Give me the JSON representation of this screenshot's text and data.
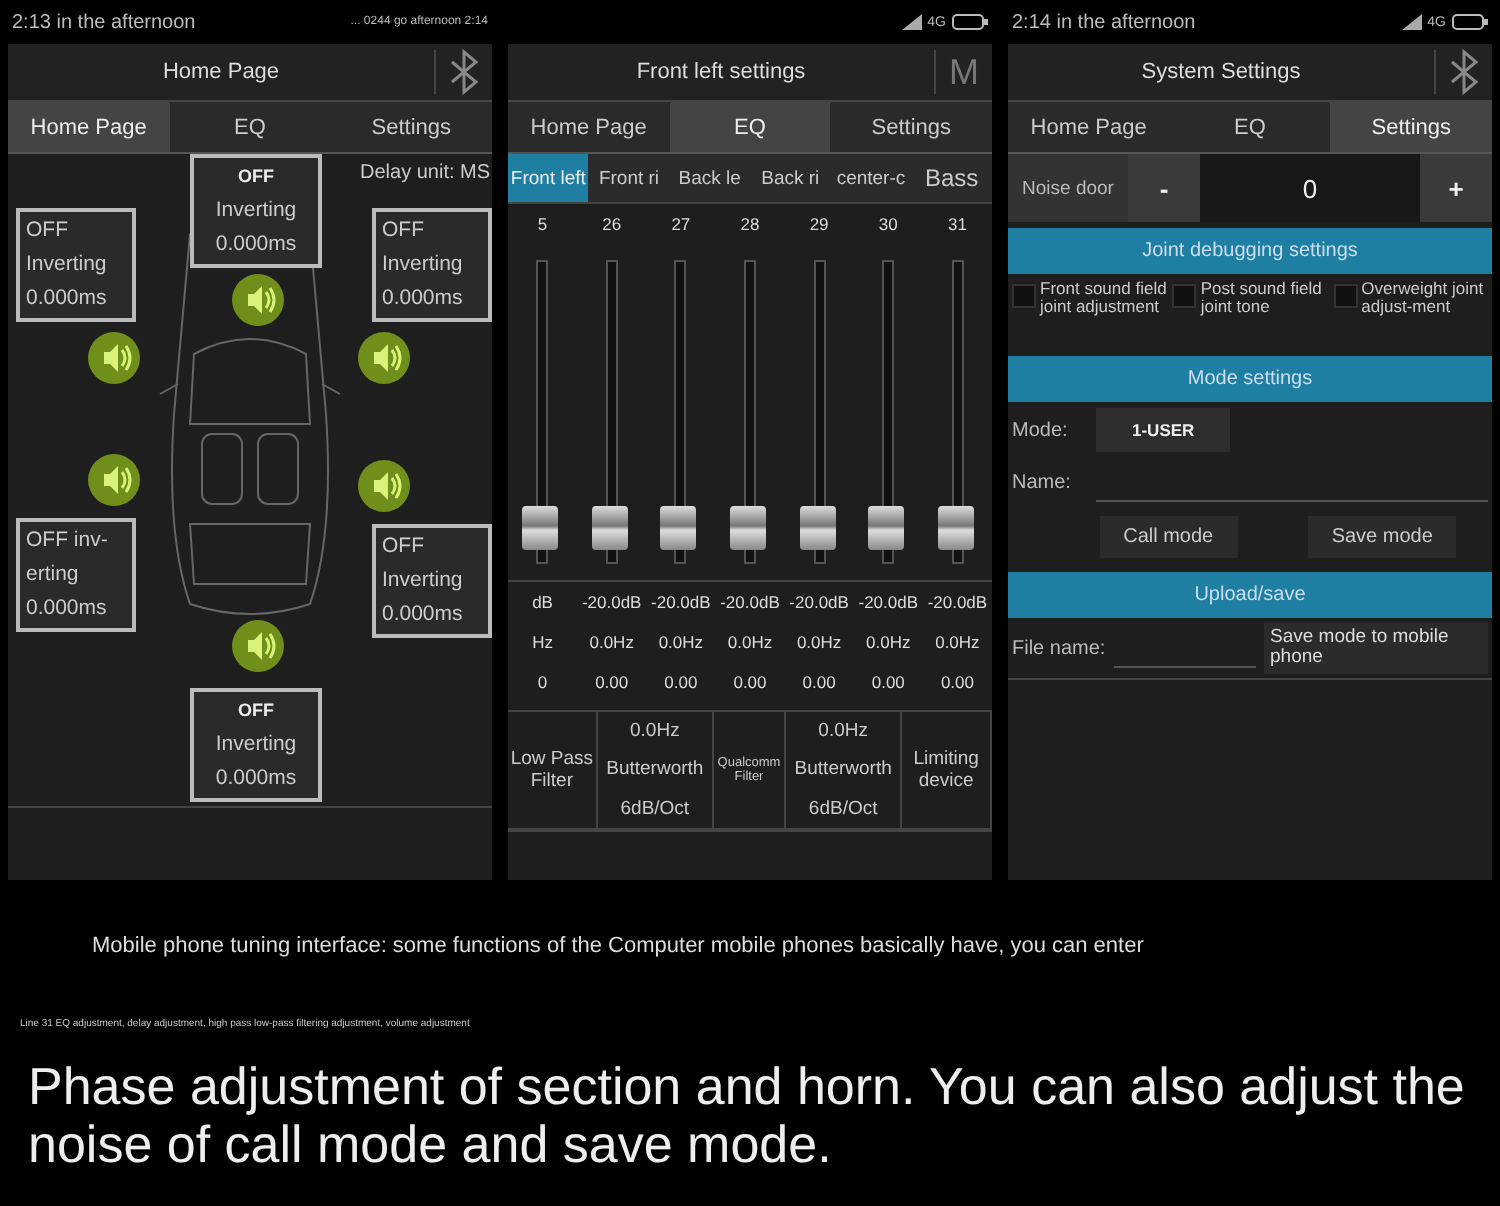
{
  "screens": [
    {
      "kind": "home",
      "status": {
        "time": "2:13 in the afternoon",
        "note": "... 0244 go afternoon 2:14"
      },
      "title": "Home Page",
      "tabs": [
        {
          "label": "Home Page",
          "selected": true
        },
        {
          "label": "EQ",
          "selected": false
        },
        {
          "label": "Settings",
          "selected": false
        }
      ],
      "delay_unit": "Delay unit: MS",
      "speakers": [
        {
          "lines": [
            "OFF",
            "Inverting",
            "0.000ms"
          ]
        },
        {
          "lines": [
            "OFF",
            "Inverting",
            "0.000ms"
          ]
        },
        {
          "lines": [
            "OFF",
            "Inverting",
            "0.000ms"
          ]
        },
        {
          "lines": [
            "OFF inv-",
            "erting",
            "0.000ms"
          ]
        },
        {
          "lines": [
            "OFF",
            "Inverting",
            "0.000ms"
          ]
        },
        {
          "lines": [
            "OFF",
            "Inverting",
            "0.000ms"
          ]
        }
      ]
    },
    {
      "kind": "eq",
      "status": {
        "network": "4G"
      },
      "title": "Front left settings",
      "title_mark": "M",
      "tabs": [
        {
          "label": "Home Page",
          "selected": false
        },
        {
          "label": "EQ",
          "selected": true
        },
        {
          "label": "Settings",
          "selected": false
        }
      ],
      "channels": [
        {
          "label": "Front left",
          "selected": true
        },
        {
          "label": "Front ri",
          "selected": false
        },
        {
          "label": "Back le",
          "selected": false
        },
        {
          "label": "Back ri",
          "selected": false
        },
        {
          "label": "center-c",
          "selected": false
        },
        {
          "label": "Bass",
          "selected": false
        }
      ],
      "bands": [
        {
          "number": "5",
          "gain": "dB",
          "freq": "Hz",
          "q": "0",
          "level": 0.05
        },
        {
          "number": "26",
          "gain": "-20.0dB",
          "freq": "0.0Hz",
          "q": "0.00",
          "level": 0.05
        },
        {
          "number": "27",
          "gain": "-20.0dB",
          "freq": "0.0Hz",
          "q": "0.00",
          "level": 0.05
        },
        {
          "number": "28",
          "gain": "-20.0dB",
          "freq": "0.0Hz",
          "q": "0.00",
          "level": 0.05
        },
        {
          "number": "29",
          "gain": "-20.0dB",
          "freq": "0.0Hz",
          "q": "0.00",
          "level": 0.05
        },
        {
          "number": "30",
          "gain": "-20.0dB",
          "freq": "0.0Hz",
          "q": "0.00",
          "level": 0.05
        },
        {
          "number": "31",
          "gain": "-20.0dB",
          "freq": "0.0Hz",
          "q": "0.00",
          "level": 0.05
        }
      ],
      "filters": [
        {
          "kind": "label",
          "text": "Low Pass Filter"
        },
        {
          "kind": "settings",
          "lines": [
            "0.0Hz",
            "Butterworth",
            "6dB/Oct"
          ]
        },
        {
          "kind": "small",
          "text": "Qualcomm Filter"
        },
        {
          "kind": "settings",
          "lines": [
            "0.0Hz",
            "Butterworth",
            "6dB/Oct"
          ]
        },
        {
          "kind": "label",
          "text": "Limiting device"
        }
      ]
    },
    {
      "kind": "settings",
      "status": {
        "time": "2:14 in the afternoon",
        "network": "4G"
      },
      "title": "System Settings",
      "tabs": [
        {
          "label": "Home Page",
          "selected": false
        },
        {
          "label": "EQ",
          "selected": false
        },
        {
          "label": "Settings",
          "selected": true
        }
      ],
      "noise": {
        "label": "Noise door",
        "minus": "-",
        "value": "0",
        "plus": "+"
      },
      "joint_header": "Joint debugging settings",
      "joints": [
        {
          "label": "Front sound field joint adjustment",
          "checked": false
        },
        {
          "label": "Post sound field joint tone",
          "checked": false
        },
        {
          "label": "Overweight joint adjust-ment",
          "checked": false
        }
      ],
      "mode_header": "Mode settings",
      "mode_label": "Mode:",
      "mode_value": "1-USER",
      "name_label": "Name:",
      "mode_buttons": [
        "Call mode",
        "Save mode"
      ],
      "upload_header": "Upload/save",
      "file_label": "File name:",
      "save_button": "Save mode to mobile phone"
    }
  ],
  "captions": {
    "intro": "Mobile phone tuning interface: some functions of the Computer mobile phones basically have, you can enter",
    "detail": "Line 31 EQ adjustment, delay adjustment, high pass low-pass filtering adjustment, volume adjustment",
    "main": "Phase adjustment of section and horn. You can also adjust the noise of call mode and save mode."
  }
}
